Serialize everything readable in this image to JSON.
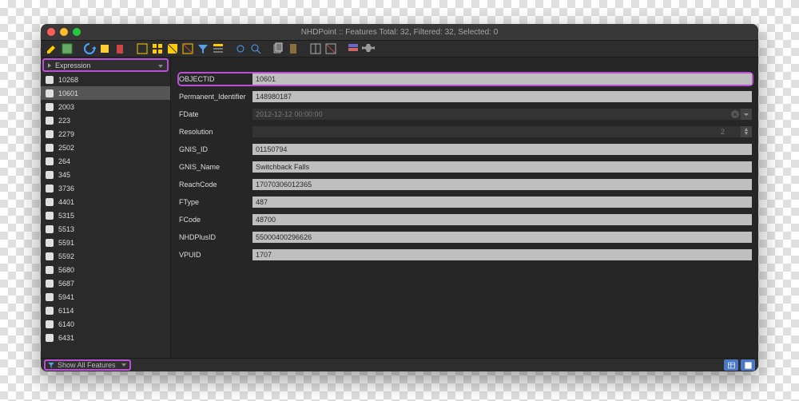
{
  "title": "NHDPoint :: Features Total: 32, Filtered: 32, Selected: 0",
  "expression_label": "Expression",
  "footer": {
    "show_all": "Show All Features"
  },
  "rows": [
    "10268",
    "10601",
    "2003",
    "223",
    "2279",
    "2502",
    "264",
    "345",
    "3736",
    "4401",
    "5315",
    "5513",
    "5591",
    "5592",
    "5680",
    "5687",
    "5941",
    "6114",
    "6140",
    "6431"
  ],
  "selected_index": 1,
  "form": {
    "OBJECTID": "10601",
    "Permanent_Identifier": "148980187",
    "FDate": "2012-12-12 00:00:00",
    "Resolution": "2",
    "GNIS_ID": "01150794",
    "GNIS_Name": "Switchback Falls",
    "ReachCode": "17070306012365",
    "FType": "487",
    "FCode": "48700",
    "NHDPlusID": "55000400296626",
    "VPUID": "1707"
  },
  "labels": {
    "OBJECTID": "OBJECTID",
    "Permanent_Identifier": "Permanent_Identifier",
    "FDate": "FDate",
    "Resolution": "Resolution",
    "GNIS_ID": "GNIS_ID",
    "GNIS_Name": "GNIS_Name",
    "ReachCode": "ReachCode",
    "FType": "FType",
    "FCode": "FCode",
    "NHDPlusID": "NHDPlusID",
    "VPUID": "VPUID"
  }
}
